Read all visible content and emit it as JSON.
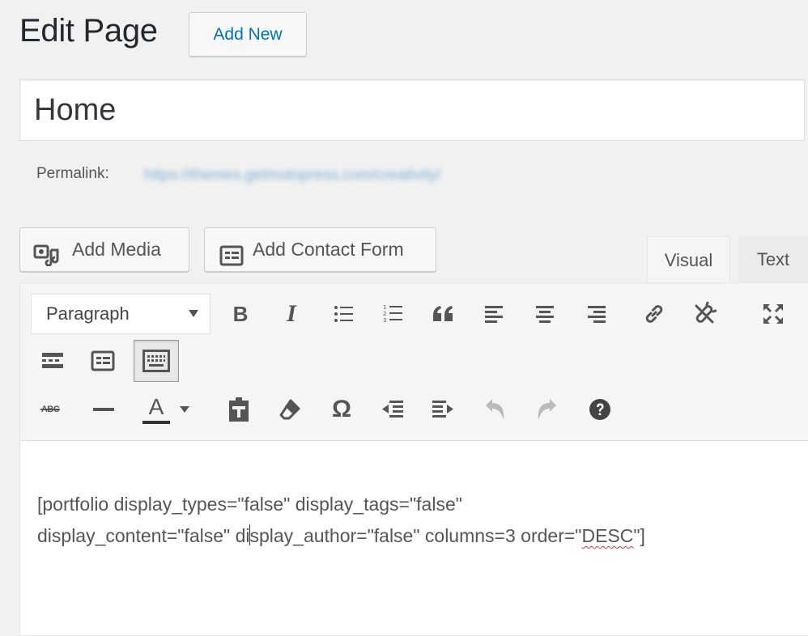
{
  "header": {
    "title": "Edit Page",
    "add_new_label": "Add New"
  },
  "post": {
    "title_value": "Home",
    "permalink_label": "Permalink:",
    "permalink_url": "https://themes.getmotopress.com/creativity/"
  },
  "media_buttons": [
    {
      "label": "Add Media",
      "icon": "add-media-icon"
    },
    {
      "label": "Add Contact Form",
      "icon": "contact-form-icon"
    }
  ],
  "editor_tabs": {
    "visual": "Visual",
    "text": "Text"
  },
  "toolbar": {
    "format_value": "Paragraph",
    "row1_icons": [
      "bold-icon",
      "italic-icon",
      "bulleted-list-icon",
      "numbered-list-icon",
      "blockquote-icon",
      "align-left-icon",
      "align-center-icon",
      "align-right-icon",
      "insert-link-icon",
      "remove-link-icon",
      "fullscreen-icon"
    ],
    "row2_icons": [
      "read-more-icon",
      "contact-form-insert-icon",
      "toolbar-toggle-icon"
    ],
    "row3_icons": [
      "strikethrough-icon",
      "horizontal-line-icon",
      "text-color-icon",
      "paste-as-text-icon",
      "clear-formatting-icon",
      "special-character-icon",
      "outdent-icon",
      "indent-icon",
      "undo-icon",
      "redo-icon",
      "help-icon"
    ],
    "bold_glyph": "B",
    "italic_glyph": "I",
    "text_color_glyph": "A",
    "omega_glyph": "Ω",
    "strike_glyph": "ABC"
  },
  "content": {
    "line1": "[portfolio display_types=\"false\" display_tags=\"false\"",
    "line2_pre_cursor": "display_content=\"false\" di",
    "line2_post_cursor": "splay_author=\"false\" columns=3 order=\"",
    "line2_misspelled": "DESC",
    "line2_end": "\"]"
  },
  "colors": {
    "link_blue": "#0073aa",
    "spellcheck_red": "#dd3333"
  }
}
